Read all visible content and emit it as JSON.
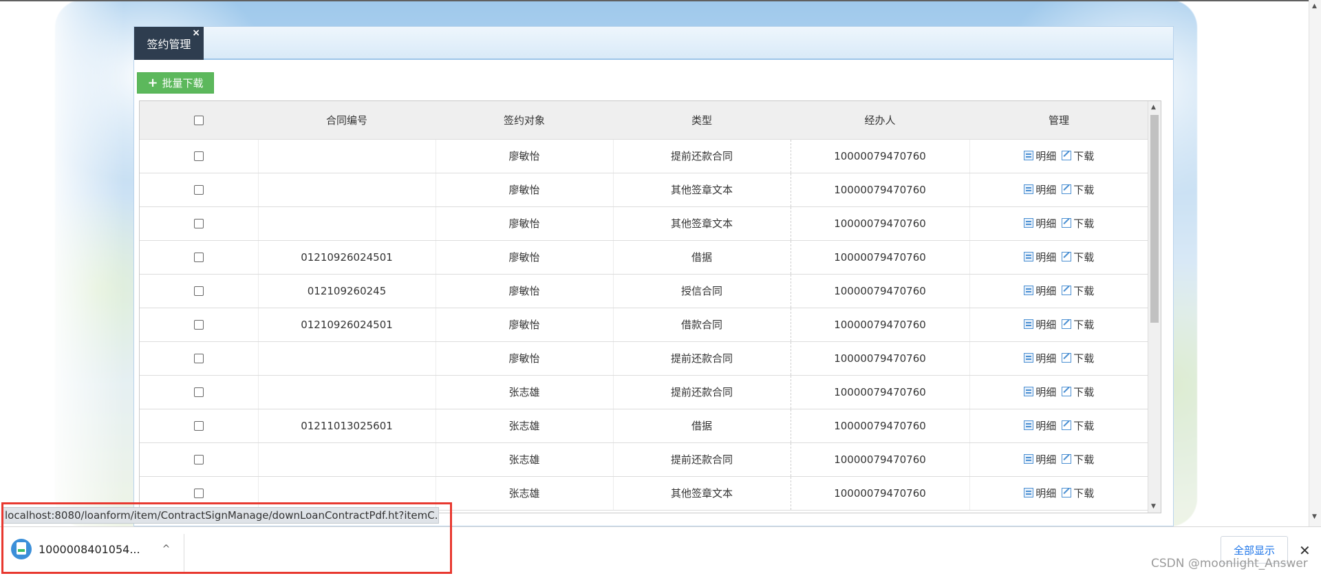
{
  "panel": {
    "tab": {
      "label": "签约管理",
      "close": "×"
    },
    "toolbar": {
      "batch_download_label": "批量下载",
      "plus": "+"
    }
  },
  "table": {
    "columns": [
      "合同编号",
      "签约对象",
      "类型",
      "经办人",
      "管理"
    ],
    "actions": {
      "detail": "明细",
      "download": "下载"
    },
    "rows": [
      {
        "contract_no": "",
        "party": "廖敏怡",
        "type": "提前还款合同",
        "handler": "10000079470760"
      },
      {
        "contract_no": "",
        "party": "廖敏怡",
        "type": "其他签章文本",
        "handler": "10000079470760"
      },
      {
        "contract_no": "",
        "party": "廖敏怡",
        "type": "其他签章文本",
        "handler": "10000079470760"
      },
      {
        "contract_no": "01210926024501",
        "party": "廖敏怡",
        "type": "借据",
        "handler": "10000079470760"
      },
      {
        "contract_no": "012109260245",
        "party": "廖敏怡",
        "type": "授信合同",
        "handler": "10000079470760"
      },
      {
        "contract_no": "01210926024501",
        "party": "廖敏怡",
        "type": "借款合同",
        "handler": "10000079470760"
      },
      {
        "contract_no": "",
        "party": "廖敏怡",
        "type": "提前还款合同",
        "handler": "10000079470760"
      },
      {
        "contract_no": "",
        "party": "张志雄",
        "type": "提前还款合同",
        "handler": "10000079470760"
      },
      {
        "contract_no": "01211013025601",
        "party": "张志雄",
        "type": "借据",
        "handler": "10000079470760"
      },
      {
        "contract_no": "",
        "party": "张志雄",
        "type": "提前还款合同",
        "handler": "10000079470760"
      },
      {
        "contract_no": "",
        "party": "张志雄",
        "type": "其他签章文本",
        "handler": "10000079470760"
      }
    ]
  },
  "status_url": "localhost:8080/loanform/item/ContractSignManage/downLoanContractPdf.ht?itemC...",
  "download_bar": {
    "file_name": "1000008401054...",
    "chevron": "^",
    "show_all_label": "全部显示",
    "close": "✕"
  },
  "watermark": "CSDN @moonlight_Answer",
  "colors": {
    "accent_green": "#5cb85c",
    "tab_dark": "#2e3d4f",
    "highlight_red": "#e8382f",
    "link_blue": "#1a73e8"
  },
  "icons": {
    "detail": "document-icon",
    "download": "edit-icon",
    "file": "pdf-file-icon"
  }
}
